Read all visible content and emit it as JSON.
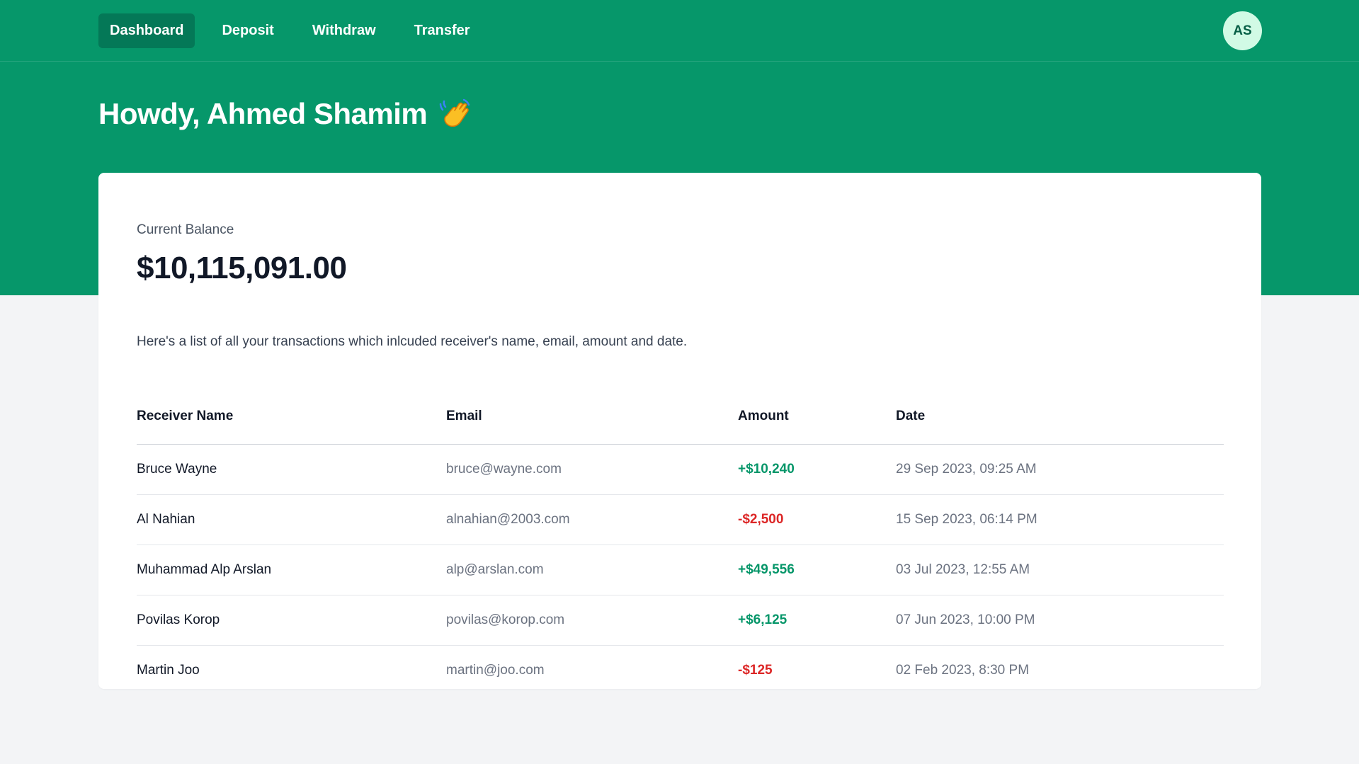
{
  "nav": {
    "links": [
      "Dashboard",
      "Deposit",
      "Withdraw",
      "Transfer"
    ],
    "active": "Dashboard",
    "avatar_initials": "AS"
  },
  "greeting": {
    "text": "Howdy, Ahmed Shamim",
    "icon": "waving-hand-icon"
  },
  "balance": {
    "label": "Current Balance",
    "value": "$10,115,091.00"
  },
  "description": "Here's a list of all your transactions which inlcuded receiver's name, email, amount and date.",
  "table": {
    "headers": [
      "Receiver Name",
      "Email",
      "Amount",
      "Date"
    ],
    "rows": [
      {
        "name": "Bruce Wayne",
        "email": "bruce@wayne.com",
        "amount": "+$10,240",
        "date": "29 Sep 2023, 09:25 AM",
        "type": "credit"
      },
      {
        "name": "Al Nahian",
        "email": "alnahian@2003.com",
        "amount": "-$2,500",
        "date": "15 Sep 2023, 06:14 PM",
        "type": "debit"
      },
      {
        "name": "Muhammad Alp Arslan",
        "email": "alp@arslan.com",
        "amount": "+$49,556",
        "date": "03 Jul 2023, 12:55 AM",
        "type": "credit"
      },
      {
        "name": "Povilas Korop",
        "email": "povilas@korop.com",
        "amount": "+$6,125",
        "date": "07 Jun 2023, 10:00 PM",
        "type": "credit"
      },
      {
        "name": "Martin Joo",
        "email": "martin@joo.com",
        "amount": "-$125",
        "date": "02 Feb 2023, 8:30 PM",
        "type": "debit"
      }
    ]
  },
  "colors": {
    "brand": "#06976a",
    "active_nav": "#047857",
    "credit": "#059669",
    "debit": "#dc2626",
    "page_bg": "#f3f4f6"
  }
}
